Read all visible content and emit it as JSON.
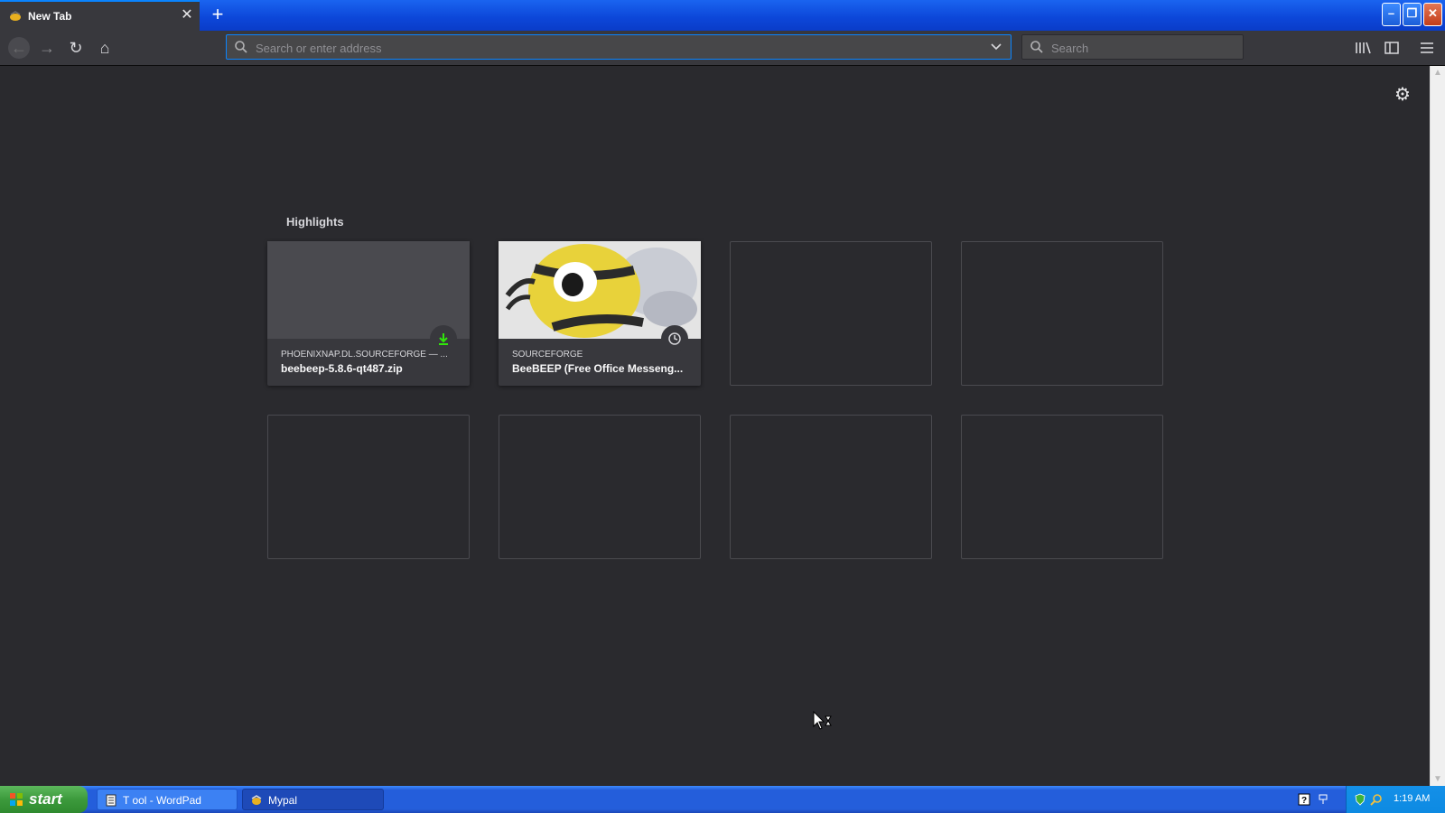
{
  "browser": {
    "tab": {
      "title": "New Tab"
    },
    "urlbar": {
      "placeholder": "Search or enter address",
      "value": ""
    },
    "searchbar": {
      "placeholder": "Search"
    }
  },
  "newtab": {
    "highlights_title": "Highlights",
    "cards": [
      {
        "host": "PHOENIXNAP.DL.SOURCEFORGE — ...",
        "title": "beebeep-5.8.6-qt487.zip",
        "badge": "download-icon"
      },
      {
        "host": "SOURCEFORGE",
        "title": "BeeBEEP (Free Office Messeng...",
        "badge": "history-icon"
      }
    ],
    "empty_slots": 6
  },
  "taskbar": {
    "start_label": "start",
    "items": [
      {
        "label": "T ool - WordPad"
      },
      {
        "label": "Mypal"
      }
    ],
    "clock": "1:19 AM"
  },
  "colors": {
    "accent": "#0a84ff",
    "page_bg": "#2a2a2e",
    "toolbar_bg": "#38383d",
    "download_badge": "#30e60b"
  }
}
